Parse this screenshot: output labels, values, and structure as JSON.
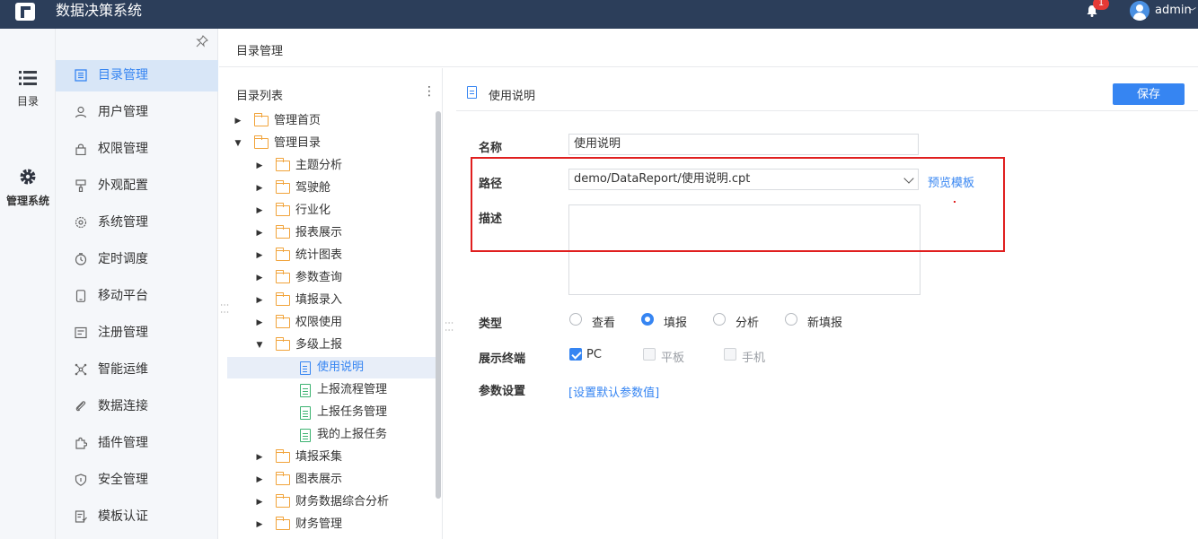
{
  "app": {
    "title": "数据决策系统",
    "notification_count": "1",
    "username": "admin"
  },
  "rail": [
    {
      "label": "目录",
      "icon": "list-icon"
    },
    {
      "label": "管理系统",
      "icon": "gear-icon"
    }
  ],
  "sidebar": {
    "items": [
      {
        "label": "目录管理",
        "icon": "catalog-icon"
      },
      {
        "label": "用户管理",
        "icon": "user-icon"
      },
      {
        "label": "权限管理",
        "icon": "lock-icon"
      },
      {
        "label": "外观配置",
        "icon": "appearance-icon"
      },
      {
        "label": "系统管理",
        "icon": "settings-icon"
      },
      {
        "label": "定时调度",
        "icon": "clock-icon"
      },
      {
        "label": "移动平台",
        "icon": "mobile-icon"
      },
      {
        "label": "注册管理",
        "icon": "register-icon"
      },
      {
        "label": "智能运维",
        "icon": "ops-icon"
      },
      {
        "label": "数据连接",
        "icon": "link-icon"
      },
      {
        "label": "插件管理",
        "icon": "plugin-icon"
      },
      {
        "label": "安全管理",
        "icon": "shield-icon"
      },
      {
        "label": "模板认证",
        "icon": "template-icon"
      }
    ]
  },
  "breadcrumb": "目录管理",
  "tree": {
    "header": "目录列表",
    "nodes": [
      {
        "label": "管理首页",
        "type": "folder",
        "level": 0,
        "expanded": false
      },
      {
        "label": "管理目录",
        "type": "folder",
        "level": 0,
        "expanded": true
      },
      {
        "label": "主题分析",
        "type": "folder",
        "level": 1,
        "expanded": false
      },
      {
        "label": "驾驶舱",
        "type": "folder",
        "level": 1,
        "expanded": false
      },
      {
        "label": "行业化",
        "type": "folder",
        "level": 1,
        "expanded": false
      },
      {
        "label": "报表展示",
        "type": "folder",
        "level": 1,
        "expanded": false
      },
      {
        "label": "统计图表",
        "type": "folder",
        "level": 1,
        "expanded": false
      },
      {
        "label": "参数查询",
        "type": "folder",
        "level": 1,
        "expanded": false
      },
      {
        "label": "填报录入",
        "type": "folder",
        "level": 1,
        "expanded": false
      },
      {
        "label": "权限使用",
        "type": "folder",
        "level": 1,
        "expanded": false
      },
      {
        "label": "多级上报",
        "type": "folder",
        "level": 1,
        "expanded": true
      },
      {
        "label": "使用说明",
        "type": "doc",
        "level": 2,
        "selected": true
      },
      {
        "label": "上报流程管理",
        "type": "form",
        "level": 2
      },
      {
        "label": "上报任务管理",
        "type": "form",
        "level": 2
      },
      {
        "label": "我的上报任务",
        "type": "form",
        "level": 2
      },
      {
        "label": "填报采集",
        "type": "folder",
        "level": 1,
        "expanded": false
      },
      {
        "label": "图表展示",
        "type": "folder",
        "level": 1,
        "expanded": false
      },
      {
        "label": "财务数据综合分析",
        "type": "folder",
        "level": 1,
        "expanded": false
      },
      {
        "label": "财务管理",
        "type": "folder",
        "level": 1,
        "expanded": false
      }
    ]
  },
  "detail": {
    "title": "使用说明",
    "save_label": "保存",
    "name_label": "名称",
    "name_value": "使用说明",
    "path_label": "路径",
    "path_value": "demo/DataReport/使用说明.cpt",
    "preview_link": "预览模板",
    "desc_label": "描述",
    "type_label": "类型",
    "type_options": [
      "查看",
      "填报",
      "分析",
      "新填报"
    ],
    "type_selected": "填报",
    "terminal_label": "展示终端",
    "terminals": [
      {
        "label": "PC",
        "checked": true,
        "disabled": false
      },
      {
        "label": "平板",
        "checked": false,
        "disabled": true
      },
      {
        "label": "手机",
        "checked": false,
        "disabled": true
      }
    ],
    "param_label": "参数设置",
    "param_link": "[设置默认参数值]"
  },
  "colors": {
    "topbar": "#2c3e5a",
    "accent": "#3685f2",
    "highlight_box": "#e01f1f",
    "folder": "#f1a33a",
    "form": "#3cb371"
  }
}
